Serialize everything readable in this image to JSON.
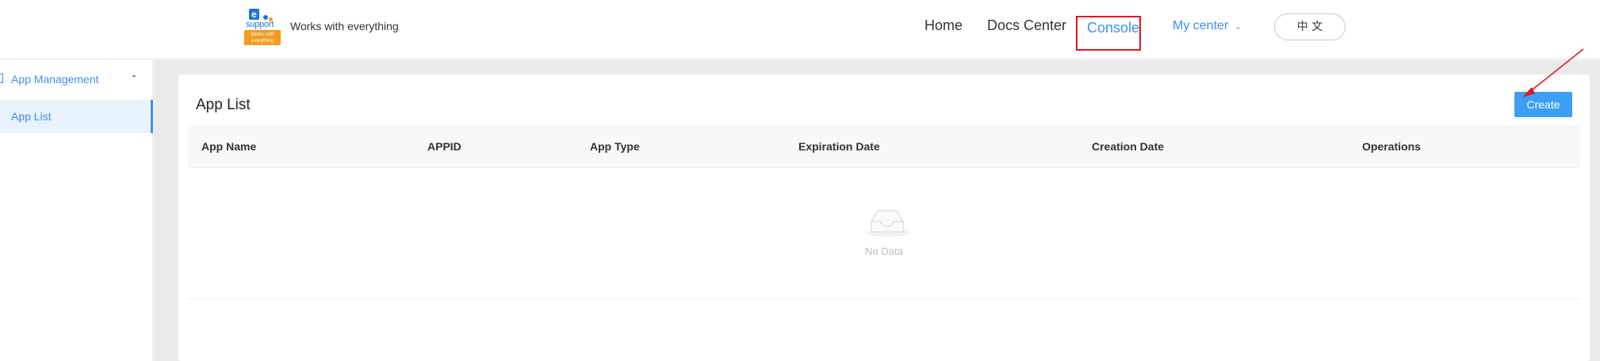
{
  "header": {
    "logo": {
      "letter": "e",
      "word": "support",
      "badge_line1": "Works with",
      "badge_line2": "everything"
    },
    "tagline": "Works with everything",
    "nav": {
      "home": "Home",
      "docs": "Docs Center",
      "console": "Console",
      "my_center": "My center",
      "my_center_caret": "⌄"
    },
    "language_button": "中 文"
  },
  "sidebar": {
    "group": {
      "label": "App Management",
      "caret": "⌃",
      "icon": "app-grid-icon"
    },
    "items": [
      {
        "label": "App List",
        "active": true
      }
    ]
  },
  "main": {
    "title": "App List",
    "create_label": "Create",
    "table": {
      "columns": [
        "App Name",
        "APPID",
        "App Type",
        "Expiration Date",
        "Creation Date",
        "Operations"
      ],
      "rows": [],
      "empty_text": "No Data"
    }
  },
  "colors": {
    "accent": "#3d8ef0",
    "create_button": "#3c9ff5",
    "highlight_box": "#e5161b",
    "annotation_arrow": "#e5161b",
    "logo_blue": "#1f76d2",
    "logo_orange": "#f39c1f"
  }
}
